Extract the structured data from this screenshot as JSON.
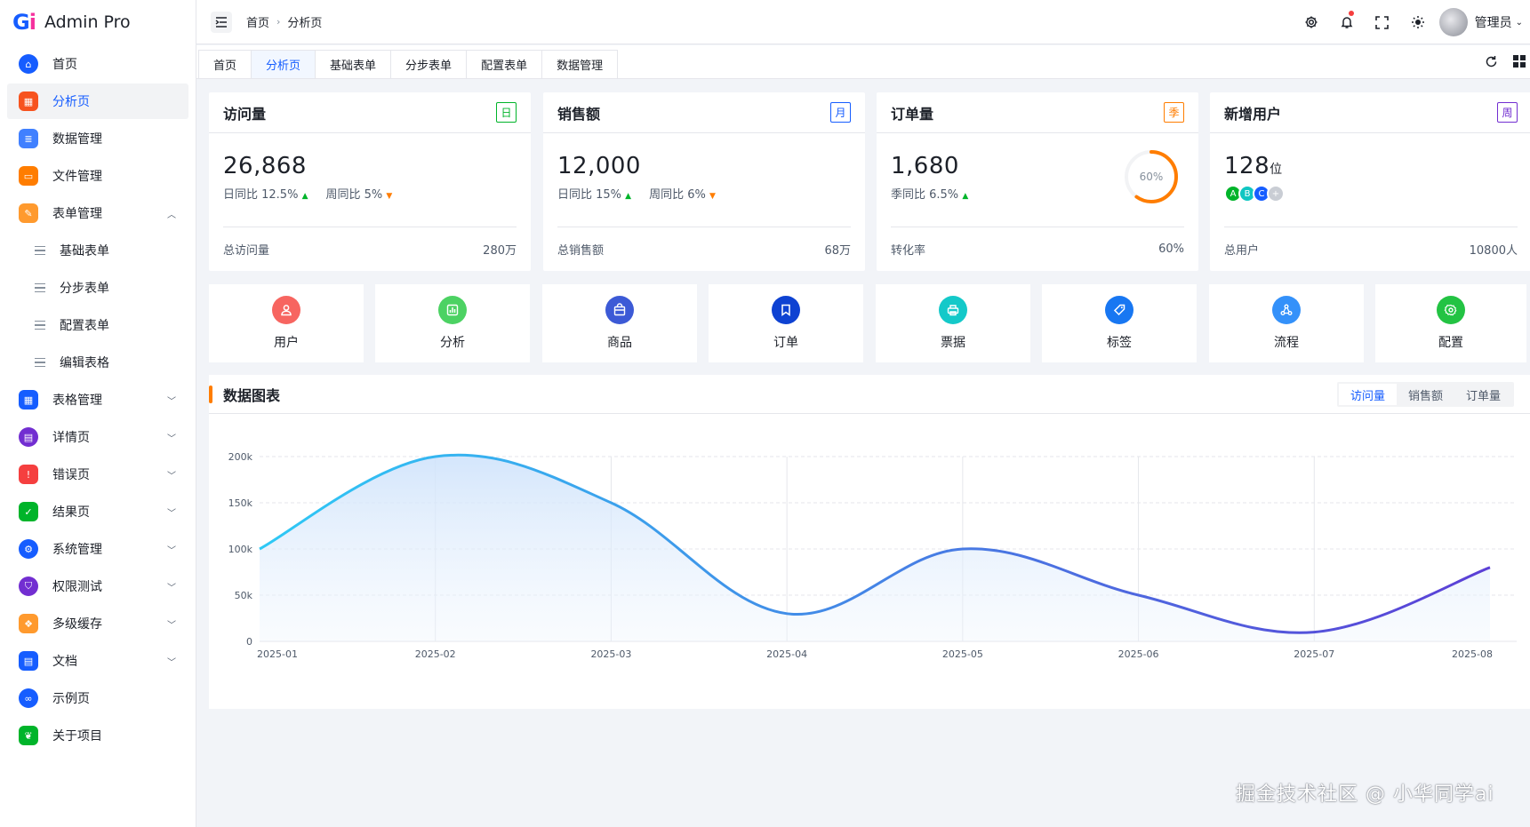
{
  "app": {
    "logo_mark_g": "G",
    "logo_mark_i": "i",
    "title": "Admin Pro"
  },
  "sidebar": {
    "items": [
      {
        "label": "首页",
        "icon": "home-icon",
        "color": "#165dff",
        "active": false
      },
      {
        "label": "分析页",
        "icon": "analysis-icon",
        "color": "#f7531e",
        "active": true
      },
      {
        "label": "数据管理",
        "icon": "data-icon",
        "color": "#4080ff",
        "active": false
      },
      {
        "label": "文件管理",
        "icon": "folder-icon",
        "color": "#ff7d00",
        "active": false
      },
      {
        "label": "表单管理",
        "icon": "form-icon",
        "color": "#ff9a2e",
        "active": false,
        "expanded": true
      }
    ],
    "sub_items": [
      "基础表单",
      "分步表单",
      "配置表单",
      "编辑表格"
    ],
    "items_after": [
      {
        "label": "表格管理",
        "icon": "table-icon",
        "color": "#165dff"
      },
      {
        "label": "详情页",
        "icon": "detail-icon",
        "color": "#722ed1"
      },
      {
        "label": "错误页",
        "icon": "error-icon",
        "color": "#f53f3f"
      },
      {
        "label": "结果页",
        "icon": "result-icon",
        "color": "#00b42a"
      },
      {
        "label": "系统管理",
        "icon": "system-icon",
        "color": "#165dff"
      },
      {
        "label": "权限测试",
        "icon": "permission-icon",
        "color": "#722ed1"
      },
      {
        "label": "多级缓存",
        "icon": "cache-icon",
        "color": "#ff9a2e"
      },
      {
        "label": "文档",
        "icon": "doc-icon",
        "color": "#165dff"
      },
      {
        "label": "示例页",
        "icon": "example-icon",
        "color": "#165dff"
      },
      {
        "label": "关于项目",
        "icon": "leaf-icon",
        "color": "#00b42a"
      }
    ]
  },
  "header": {
    "breadcrumb": [
      "首页",
      "分析页"
    ],
    "user_name": "管理员"
  },
  "tabs": [
    "首页",
    "分析页",
    "基础表单",
    "分步表单",
    "配置表单",
    "数据管理"
  ],
  "active_tab": "分析页",
  "stats": [
    {
      "title": "访问量",
      "tag": "日",
      "tag_color": "#00b42a",
      "value": "26,868",
      "sub": [
        {
          "label": "日同比 12.5%",
          "trend": "up"
        },
        {
          "label": "周同比 5%",
          "trend": "down"
        }
      ],
      "foot_label": "总访问量",
      "foot_value": "280万"
    },
    {
      "title": "销售额",
      "tag": "月",
      "tag_color": "#165dff",
      "value": "12,000",
      "sub": [
        {
          "label": "日同比 15%",
          "trend": "up"
        },
        {
          "label": "周同比 6%",
          "trend": "down"
        }
      ],
      "foot_label": "总销售额",
      "foot_value": "68万"
    },
    {
      "title": "订单量",
      "tag": "季",
      "tag_color": "#ff7d00",
      "value": "1,680",
      "sub": [
        {
          "label": "季同比 6.5%",
          "trend": "up"
        }
      ],
      "ring_label": "60%",
      "ring_value": 0.6,
      "foot_label": "转化率",
      "foot_value": "60%"
    },
    {
      "title": "新增用户",
      "tag": "周",
      "tag_color": "#722ed1",
      "value": "128",
      "unit": "位",
      "avatars": [
        {
          "t": "A",
          "c": "#00b42a"
        },
        {
          "t": "B",
          "c": "#0fc6c2"
        },
        {
          "t": "C",
          "c": "#165dff"
        },
        {
          "t": "+",
          "c": "#c9cdd4"
        }
      ],
      "foot_label": "总用户",
      "foot_value": "10800人"
    }
  ],
  "shortcuts": [
    {
      "label": "用户",
      "icon": "user-icon",
      "color": "#f76560"
    },
    {
      "label": "分析",
      "icon": "bar-chart-icon",
      "color": "#4cd263"
    },
    {
      "label": "商品",
      "icon": "goods-icon",
      "color": "#3c5ad6"
    },
    {
      "label": "订单",
      "icon": "bookmark-icon",
      "color": "#0e42d2"
    },
    {
      "label": "票据",
      "icon": "printer-icon",
      "color": "#14c9c9"
    },
    {
      "label": "标签",
      "icon": "tag-icon",
      "color": "#1877f2"
    },
    {
      "label": "流程",
      "icon": "flow-icon",
      "color": "#3491fa"
    },
    {
      "label": "配置",
      "icon": "gear-icon",
      "color": "#23c343"
    }
  ],
  "chart_panel": {
    "title": "数据图表",
    "segments": [
      "访问量",
      "销售额",
      "订单量"
    ],
    "active_segment": "访问量"
  },
  "chart_data": {
    "type": "area",
    "categories": [
      "2025-01",
      "2025-02",
      "2025-03",
      "2025-04",
      "2025-05",
      "2025-06",
      "2025-07",
      "2025-08"
    ],
    "values": [
      100000,
      200000,
      150000,
      30000,
      100000,
      50000,
      10000,
      80000
    ],
    "yticks": [
      "0",
      "50k",
      "100k",
      "150k",
      "200k"
    ],
    "ylim": [
      0,
      200000
    ],
    "grid": true,
    "line_color_start": "#2ec9f5",
    "line_color_end": "#5b3fd6"
  },
  "watermark": "掘金技术社区 @ 小华同学ai"
}
